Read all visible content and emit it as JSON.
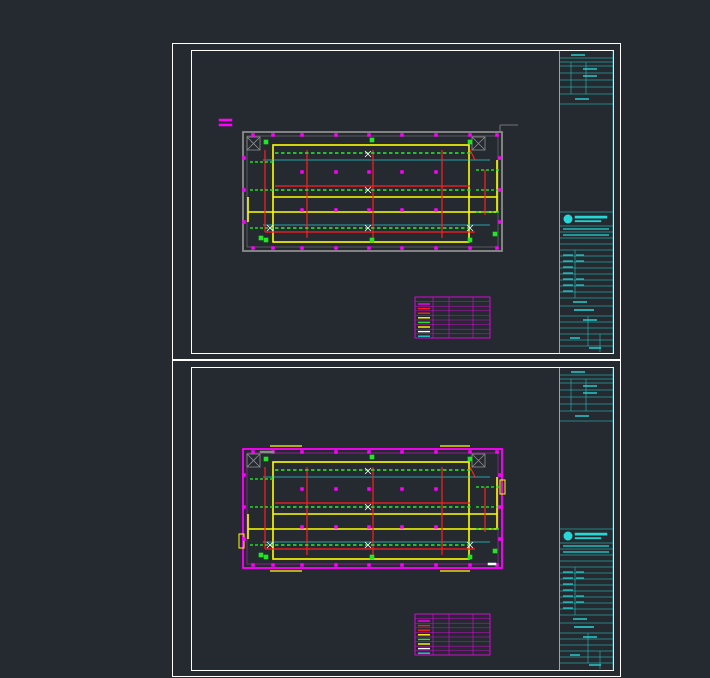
{
  "app": {
    "background_color": "#252a31"
  },
  "colors": {
    "sheet_border": "#ffffff",
    "title_block": "#27d7d7",
    "wall": "#8c8c8c",
    "yellow_line": "#ffff00",
    "red_line": "#ff1f1f",
    "green_device": "#22e622",
    "magenta": "#ff00ff",
    "cyan_line": "#22cccc"
  },
  "sheets": [
    {
      "id": "sheet-1",
      "variant": "gray-outline"
    },
    {
      "id": "sheet-2",
      "variant": "magenta-outline"
    }
  ],
  "icons": {
    "stair": "stair-cross-icon",
    "logo": "firm-logo-icon"
  }
}
